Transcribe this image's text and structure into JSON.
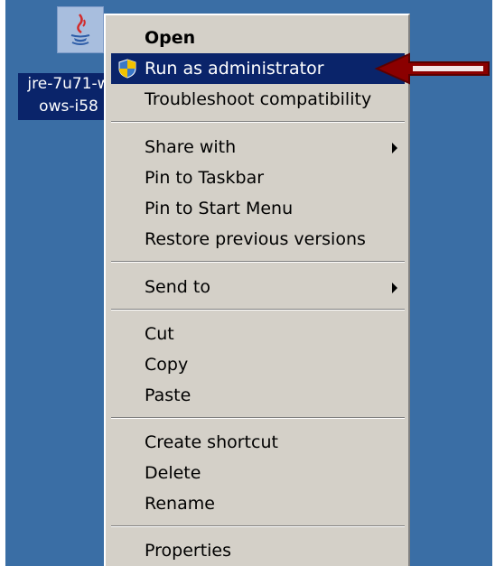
{
  "desktop_icon": {
    "icon": "java-installer-icon",
    "label_line1": "jre-7u71-w",
    "label_line2": "ows-i58"
  },
  "context_menu": {
    "items": [
      {
        "label": "Open",
        "bold": true
      },
      {
        "label": "Run as administrator",
        "icon": "uac-shield-icon",
        "highlighted": true
      },
      {
        "label": "Troubleshoot compatibility"
      },
      {
        "label": "Share with",
        "submenu": true
      },
      {
        "label": "Pin to Taskbar"
      },
      {
        "label": "Pin to Start Menu"
      },
      {
        "label": "Restore previous versions"
      },
      {
        "label": "Send to",
        "submenu": true
      },
      {
        "label": "Cut"
      },
      {
        "label": "Copy"
      },
      {
        "label": "Paste"
      },
      {
        "label": "Create shortcut"
      },
      {
        "label": "Delete"
      },
      {
        "label": "Rename"
      },
      {
        "label": "Properties"
      }
    ]
  },
  "annotation": {
    "icon": "red-pointer-arrow-icon",
    "color": "#8b0000"
  },
  "colors": {
    "desktop": "#3a6ea5",
    "menu": "#d4d0c8",
    "highlight": "#0a246a"
  }
}
